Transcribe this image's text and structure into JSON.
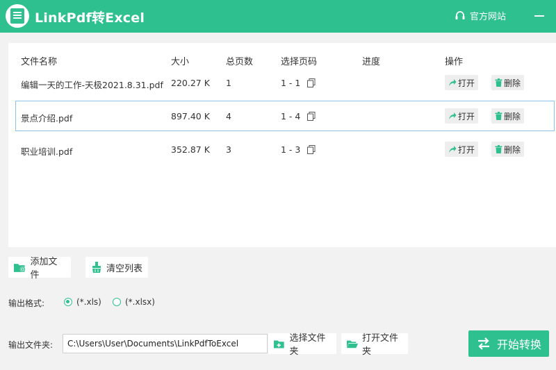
{
  "app": {
    "title": "LinkPdf转Excel",
    "site_link": "官方网站"
  },
  "colors": {
    "accent": "#2fc08f",
    "selected_border": "#8cc1ea"
  },
  "table": {
    "headers": {
      "name": "文件名称",
      "size": "大小",
      "pages": "总页数",
      "range": "选择页码",
      "progress": "进度",
      "ops": "操作"
    },
    "rows": [
      {
        "name": "编辑一天的工作-天极2021.8.31.pdf",
        "size": "220.27 K",
        "pages": "1",
        "range": "1 - 1",
        "progress": "",
        "open": "打开",
        "delete": "删除"
      },
      {
        "name": "景点介绍.pdf",
        "size": "897.40 K",
        "pages": "4",
        "range": "1 - 4",
        "progress": "",
        "open": "打开",
        "delete": "删除"
      },
      {
        "name": "职业培训.pdf",
        "size": "352.87 K",
        "pages": "3",
        "range": "1 - 3",
        "progress": "",
        "open": "打开",
        "delete": "删除"
      }
    ]
  },
  "toolbar": {
    "add_file": "添加文件",
    "clear_list": "清空列表"
  },
  "format": {
    "label": "输出格式:",
    "options": [
      "(*.xls)",
      "(*.xlsx)"
    ],
    "selected": "(*.xls)"
  },
  "output": {
    "label": "输出文件夹:",
    "path": "C:\\Users\\User\\Documents\\LinkPdfToExcel",
    "choose_folder": "选择文件夹",
    "open_folder": "打开文件夹"
  },
  "start_button": "开始转换",
  "icons": [
    "app-logo",
    "headset-icon",
    "minimize-icon",
    "copy-icon",
    "share-arrow-icon",
    "trash-icon",
    "folder-add-icon",
    "broom-icon",
    "folder-plus-icon",
    "folder-open-icon",
    "swap-arrows-icon"
  ]
}
